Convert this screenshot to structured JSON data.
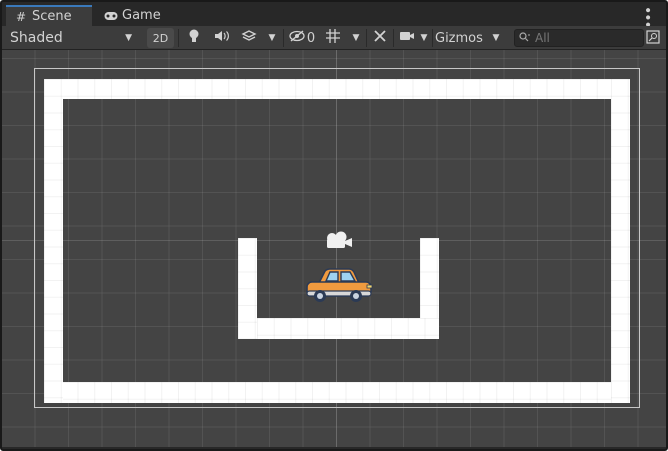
{
  "tabs": [
    {
      "label": "Scene",
      "icon": "grid-icon",
      "active": true
    },
    {
      "label": "Game",
      "icon": "gamepad-icon",
      "active": false
    }
  ],
  "toolbar": {
    "draw_mode": "Shaded",
    "mode_2d": "2D",
    "hidden_count": "0",
    "gizmos_label": "Gizmos",
    "search_placeholder": "All"
  },
  "scene": {
    "objects": [
      "outer-wall",
      "inner-wall",
      "main-camera",
      "car-sprite"
    ],
    "colors": {
      "background": "#444444",
      "wall": "#ffffff",
      "car_body": "#ef9a3f",
      "accent": "#3a79bb"
    }
  }
}
